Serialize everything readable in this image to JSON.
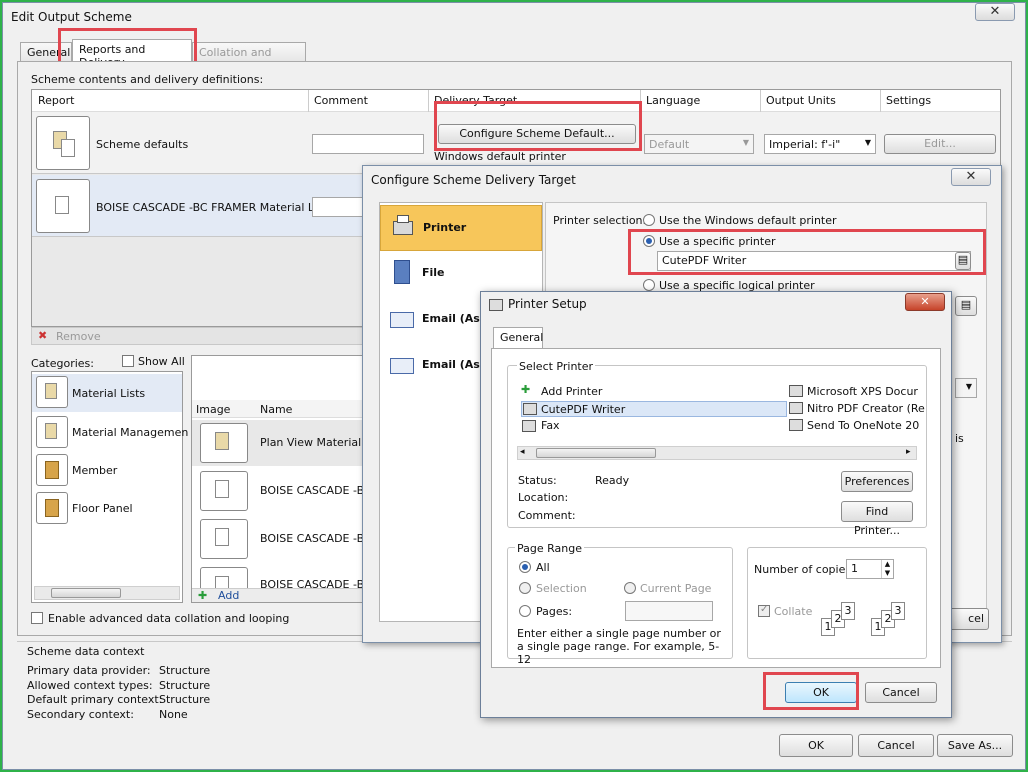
{
  "main_window": {
    "title": "Edit Output Scheme",
    "tabs": [
      {
        "label": "General"
      },
      {
        "label": "Reports and Delivery"
      },
      {
        "label": "Collation and Looping"
      }
    ],
    "section_label": "Scheme contents and delivery definitions:",
    "grid_headers": [
      "Report",
      "Comment",
      "Delivery Target",
      "Language",
      "Output Units",
      "Settings"
    ],
    "rows": [
      {
        "name": "Scheme defaults",
        "delivery_button": "Configure Scheme Default...",
        "delivery_text": "Windows default printer",
        "language": "Default",
        "units": "Imperial: f'-i\"",
        "settings_button": "Edit..."
      },
      {
        "name": "BOISE CASCADE -BC FRAMER Material List"
      }
    ],
    "remove_label": "Remove",
    "categories_label": "Categories:",
    "show_all_label": "Show All",
    "categories": [
      {
        "label": "Material Lists"
      },
      {
        "label": "Material Managemen"
      },
      {
        "label": "Member"
      },
      {
        "label": "Floor Panel"
      }
    ],
    "report_list_headers": [
      "Image",
      "Name"
    ],
    "report_list_items": [
      {
        "name": "Plan View Material L..."
      },
      {
        "name": "BOISE CASCADE -BC..."
      },
      {
        "name": "BOISE CASCADE -BC..."
      },
      {
        "name": "BOISE CASCADE -BC..."
      }
    ],
    "add_label": "Add",
    "enable_advanced_label": "Enable advanced data collation and looping",
    "context": {
      "title": "Scheme data context",
      "rows": [
        {
          "k": "Primary data provider:",
          "v": "Structure"
        },
        {
          "k": "Allowed context types:",
          "v": "Structure"
        },
        {
          "k": "Default primary context:",
          "v": "Structure"
        },
        {
          "k": "Secondary context:",
          "v": "None"
        }
      ]
    },
    "buttons": {
      "ok": "OK",
      "cancel": "Cancel",
      "save_as": "Save As..."
    }
  },
  "delivery_dialog": {
    "title": "Configure Scheme Delivery Target",
    "nav": [
      {
        "label": "Printer"
      },
      {
        "label": "File"
      },
      {
        "label": "Email (As at"
      },
      {
        "label": "Email (As bo"
      }
    ],
    "printer_selection_label": "Printer selection:",
    "options": [
      "Use the Windows default printer",
      "Use a specific printer",
      "Use a specific logical printer"
    ],
    "selected_printer": "CutePDF Writer",
    "partial_cancel": "cel",
    "partial_is": "is"
  },
  "printer_setup": {
    "title": "Printer Setup",
    "tab": "General",
    "select_printer_label": "Select Printer",
    "printers_left": [
      "Add Printer",
      "CutePDF Writer",
      "Fax"
    ],
    "printers_right": [
      "Microsoft XPS Docur",
      "Nitro PDF Creator (Re",
      "Send To OneNote 20"
    ],
    "status_label": "Status:",
    "status_value": "Ready",
    "location_label": "Location:",
    "comment_label": "Comment:",
    "preferences_button": "Preferences",
    "find_printer_button": "Find Printer...",
    "page_range_label": "Page Range",
    "all_label": "All",
    "selection_label": "Selection",
    "current_page_label": "Current Page",
    "pages_label": "Pages:",
    "page_range_hint": "Enter either a single page number or a single page range.  For example, 5-12",
    "copies_label": "Number of copies:",
    "copies_value": "1",
    "collate_label": "Collate",
    "ok": "OK",
    "cancel": "Cancel"
  },
  "colors": {
    "highlight": "#e0464f",
    "frame": "#2fb24a",
    "nav_selected": "#f7c65a"
  }
}
